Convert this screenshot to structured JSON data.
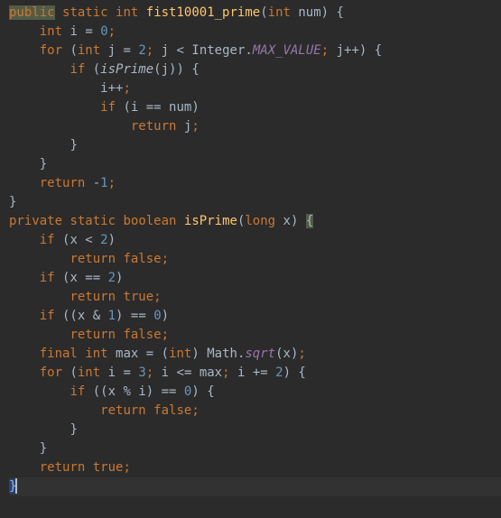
{
  "code": {
    "lines": [
      {
        "indent": 0,
        "tokens": [
          {
            "t": "public",
            "c": "kw",
            "hl": "hl"
          },
          {
            "t": " "
          },
          {
            "t": "static",
            "c": "kw"
          },
          {
            "t": " "
          },
          {
            "t": "int",
            "c": "kw"
          },
          {
            "t": " "
          },
          {
            "t": "fist10001_prime",
            "c": "fn"
          },
          {
            "t": "("
          },
          {
            "t": "int",
            "c": "kw"
          },
          {
            "t": " "
          },
          {
            "t": "num",
            "c": "id"
          },
          {
            "t": ") {"
          }
        ]
      },
      {
        "indent": 1,
        "tokens": [
          {
            "t": "int",
            "c": "kw"
          },
          {
            "t": " "
          },
          {
            "t": "i",
            "c": "id"
          },
          {
            "t": " = "
          },
          {
            "t": "0",
            "c": "num"
          },
          {
            "t": ";",
            "c": "semi"
          }
        ]
      },
      {
        "indent": 1,
        "tokens": [
          {
            "t": "for",
            "c": "kw"
          },
          {
            "t": " ("
          },
          {
            "t": "int",
            "c": "kw"
          },
          {
            "t": " "
          },
          {
            "t": "j",
            "c": "id"
          },
          {
            "t": " = "
          },
          {
            "t": "2",
            "c": "num"
          },
          {
            "t": ";",
            "c": "semi"
          },
          {
            "t": " "
          },
          {
            "t": "j",
            "c": "id"
          },
          {
            "t": " < "
          },
          {
            "t": "Integer",
            "c": "cls"
          },
          {
            "t": "."
          },
          {
            "t": "MAX_VALUE",
            "c": "stat"
          },
          {
            "t": ";",
            "c": "semi"
          },
          {
            "t": " "
          },
          {
            "t": "j",
            "c": "id"
          },
          {
            "t": "++) {"
          }
        ]
      },
      {
        "indent": 2,
        "tokens": [
          {
            "t": "if",
            "c": "kw"
          },
          {
            "t": " ("
          },
          {
            "t": "isPrime",
            "c": "call"
          },
          {
            "t": "("
          },
          {
            "t": "j",
            "c": "id"
          },
          {
            "t": ")) {"
          }
        ]
      },
      {
        "indent": 3,
        "tokens": [
          {
            "t": "i",
            "c": "id"
          },
          {
            "t": "++"
          },
          {
            "t": ";",
            "c": "semi"
          }
        ]
      },
      {
        "indent": 3,
        "tokens": [
          {
            "t": "if",
            "c": "kw"
          },
          {
            "t": " ("
          },
          {
            "t": "i",
            "c": "id"
          },
          {
            "t": " == "
          },
          {
            "t": "num",
            "c": "id"
          },
          {
            "t": ")"
          }
        ]
      },
      {
        "indent": 4,
        "tokens": [
          {
            "t": "return",
            "c": "kw"
          },
          {
            "t": " "
          },
          {
            "t": "j",
            "c": "id"
          },
          {
            "t": ";",
            "c": "semi"
          }
        ]
      },
      {
        "indent": 2,
        "tokens": [
          {
            "t": "}"
          }
        ]
      },
      {
        "indent": 1,
        "tokens": [
          {
            "t": "}"
          }
        ]
      },
      {
        "indent": 1,
        "tokens": [
          {
            "t": "return",
            "c": "kw"
          },
          {
            "t": " -"
          },
          {
            "t": "1",
            "c": "num"
          },
          {
            "t": ";",
            "c": "semi"
          }
        ]
      },
      {
        "indent": 0,
        "tokens": [
          {
            "t": "}"
          }
        ]
      },
      {
        "indent": 0,
        "tokens": []
      },
      {
        "indent": 0,
        "tokens": [
          {
            "t": "private",
            "c": "kw"
          },
          {
            "t": " "
          },
          {
            "t": "static",
            "c": "kw"
          },
          {
            "t": " "
          },
          {
            "t": "boolean",
            "c": "kw"
          },
          {
            "t": " "
          },
          {
            "t": "isPrime",
            "c": "fn"
          },
          {
            "t": "("
          },
          {
            "t": "long",
            "c": "kw"
          },
          {
            "t": " "
          },
          {
            "t": "x",
            "c": "id"
          },
          {
            "t": ") "
          },
          {
            "t": "{",
            "hl": "hl"
          }
        ]
      },
      {
        "indent": 1,
        "tokens": [
          {
            "t": "if",
            "c": "kw"
          },
          {
            "t": " ("
          },
          {
            "t": "x",
            "c": "id"
          },
          {
            "t": " < "
          },
          {
            "t": "2",
            "c": "num"
          },
          {
            "t": ")"
          }
        ]
      },
      {
        "indent": 2,
        "tokens": [
          {
            "t": "return false",
            "c": "kw"
          },
          {
            "t": ";",
            "c": "semi"
          }
        ]
      },
      {
        "indent": 1,
        "tokens": [
          {
            "t": "if",
            "c": "kw"
          },
          {
            "t": " ("
          },
          {
            "t": "x",
            "c": "id"
          },
          {
            "t": " == "
          },
          {
            "t": "2",
            "c": "num"
          },
          {
            "t": ")"
          }
        ]
      },
      {
        "indent": 2,
        "tokens": [
          {
            "t": "return true",
            "c": "kw"
          },
          {
            "t": ";",
            "c": "semi"
          }
        ]
      },
      {
        "indent": 1,
        "tokens": [
          {
            "t": "if",
            "c": "kw"
          },
          {
            "t": " (("
          },
          {
            "t": "x",
            "c": "id"
          },
          {
            "t": " & "
          },
          {
            "t": "1",
            "c": "num"
          },
          {
            "t": ") == "
          },
          {
            "t": "0",
            "c": "num"
          },
          {
            "t": ")"
          }
        ]
      },
      {
        "indent": 2,
        "tokens": [
          {
            "t": "return false",
            "c": "kw"
          },
          {
            "t": ";",
            "c": "semi"
          }
        ]
      },
      {
        "indent": 1,
        "tokens": [
          {
            "t": "final",
            "c": "kw"
          },
          {
            "t": " "
          },
          {
            "t": "int",
            "c": "kw"
          },
          {
            "t": " "
          },
          {
            "t": "max",
            "c": "id"
          },
          {
            "t": " = ("
          },
          {
            "t": "int",
            "c": "kw"
          },
          {
            "t": ") "
          },
          {
            "t": "Math",
            "c": "cls"
          },
          {
            "t": "."
          },
          {
            "t": "sqrt",
            "c": "stat"
          },
          {
            "t": "("
          },
          {
            "t": "x",
            "c": "id"
          },
          {
            "t": ")"
          },
          {
            "t": ";",
            "c": "semi"
          }
        ]
      },
      {
        "indent": 1,
        "tokens": [
          {
            "t": "for",
            "c": "kw"
          },
          {
            "t": " ("
          },
          {
            "t": "int",
            "c": "kw"
          },
          {
            "t": " "
          },
          {
            "t": "i",
            "c": "id"
          },
          {
            "t": " = "
          },
          {
            "t": "3",
            "c": "num"
          },
          {
            "t": ";",
            "c": "semi"
          },
          {
            "t": " "
          },
          {
            "t": "i",
            "c": "id"
          },
          {
            "t": " <= "
          },
          {
            "t": "max",
            "c": "id"
          },
          {
            "t": ";",
            "c": "semi"
          },
          {
            "t": " "
          },
          {
            "t": "i",
            "c": "id"
          },
          {
            "t": " += "
          },
          {
            "t": "2",
            "c": "num"
          },
          {
            "t": ") {"
          }
        ]
      },
      {
        "indent": 2,
        "tokens": [
          {
            "t": "if",
            "c": "kw"
          },
          {
            "t": " (("
          },
          {
            "t": "x",
            "c": "id"
          },
          {
            "t": " % "
          },
          {
            "t": "i",
            "c": "id"
          },
          {
            "t": ") == "
          },
          {
            "t": "0",
            "c": "num"
          },
          {
            "t": ") {"
          }
        ]
      },
      {
        "indent": 3,
        "tokens": [
          {
            "t": "return false",
            "c": "kw"
          },
          {
            "t": ";",
            "c": "semi"
          }
        ]
      },
      {
        "indent": 2,
        "tokens": [
          {
            "t": "}"
          }
        ]
      },
      {
        "indent": 1,
        "tokens": [
          {
            "t": "}"
          }
        ]
      },
      {
        "indent": 1,
        "tokens": [
          {
            "t": "return true",
            "c": "kw"
          },
          {
            "t": ";",
            "c": "semi"
          }
        ]
      },
      {
        "indent": 0,
        "caret": true,
        "tokens": [
          {
            "t": "}",
            "hl": "sel"
          }
        ]
      }
    ]
  },
  "indent_unit": "    "
}
